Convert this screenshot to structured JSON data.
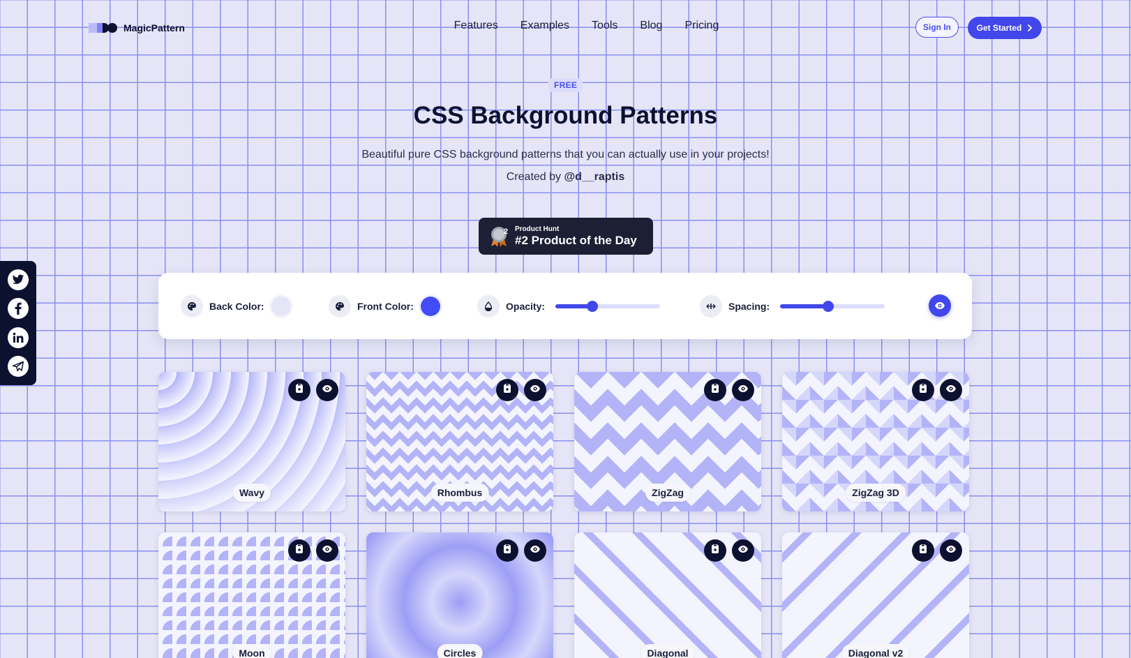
{
  "brand": {
    "name": "MagicPattern",
    "color": "#4147ea",
    "dark": "#0d1130"
  },
  "nav": {
    "items": [
      {
        "label": "Features"
      },
      {
        "label": "Examples"
      },
      {
        "label": "Tools"
      },
      {
        "label": "Blog"
      },
      {
        "label": "Pricing"
      }
    ],
    "sign_in": "Sign In",
    "get_started": "Get Started"
  },
  "hero": {
    "badge": "FREE",
    "title": "CSS Background Patterns",
    "subtitle": "Beautiful pure CSS background patterns that you can actually use in your projects!",
    "credit_prefix": "Created by ",
    "credit_handle": "@d__raptis"
  },
  "product_hunt": {
    "small": "Product Hunt",
    "big": "#2 Product of the Day",
    "rank": "2"
  },
  "social": {
    "icons": [
      "twitter-icon",
      "facebook-icon",
      "linkedin-icon",
      "telegram-icon"
    ]
  },
  "controls": {
    "back_color": {
      "label": "Back Color:",
      "value": "#e5e5f7"
    },
    "front_color": {
      "label": "Front Color:",
      "value": "#444cf7"
    },
    "opacity": {
      "label": "Opacity:",
      "value": 0.35
    },
    "spacing": {
      "label": "Spacing:",
      "value": 0.46
    }
  },
  "patterns": [
    {
      "name": "Wavy"
    },
    {
      "name": "Rhombus"
    },
    {
      "name": "ZigZag"
    },
    {
      "name": "ZigZag 3D"
    },
    {
      "name": "Moon"
    },
    {
      "name": "Circles"
    },
    {
      "name": "Diagonal"
    },
    {
      "name": "Diagonal v2"
    }
  ]
}
